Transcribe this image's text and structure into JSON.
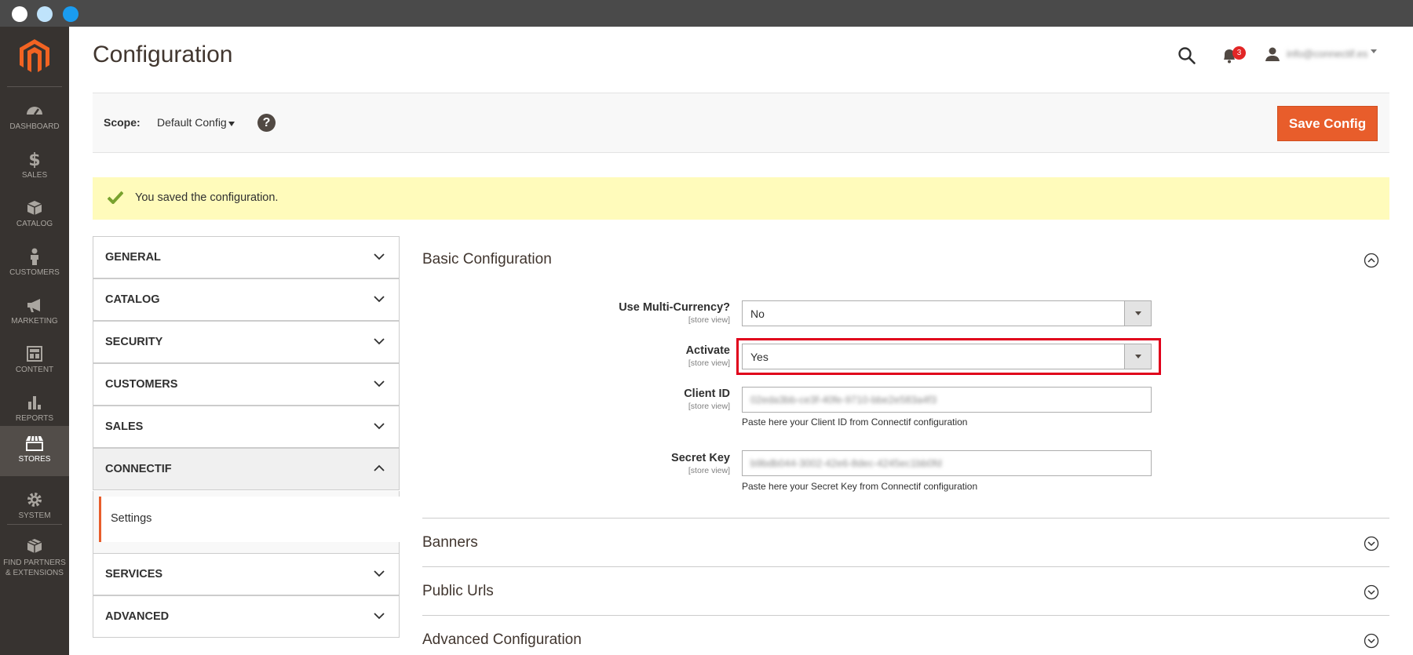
{
  "window": {
    "dot_colors": [
      "#ffffff",
      "#bfe3fb",
      "#1a9cf0"
    ]
  },
  "sidebar": {
    "items": [
      {
        "label": "DASHBOARD",
        "icon": "dashboard-icon"
      },
      {
        "label": "SALES",
        "icon": "dollar-icon"
      },
      {
        "label": "CATALOG",
        "icon": "box-icon"
      },
      {
        "label": "CUSTOMERS",
        "icon": "person-icon"
      },
      {
        "label": "MARKETING",
        "icon": "megaphone-icon"
      },
      {
        "label": "CONTENT",
        "icon": "layout-icon"
      },
      {
        "label": "REPORTS",
        "icon": "bar-chart-icon"
      },
      {
        "label": "STORES",
        "icon": "store-icon",
        "active": true
      },
      {
        "label": "SYSTEM",
        "icon": "gear-icon"
      },
      {
        "label": "FIND PARTNERS & EXTENSIONS",
        "icon": "extensions-icon"
      }
    ]
  },
  "header": {
    "title": "Configuration",
    "notification_count": "3",
    "user_name": "info@connectif.es"
  },
  "scope": {
    "label": "Scope:",
    "value": "Default Config",
    "help_icon": "?",
    "save_label": "Save Config"
  },
  "message": {
    "text": "You saved the configuration."
  },
  "tabs": {
    "general": "GENERAL",
    "catalog": "CATALOG",
    "security": "SECURITY",
    "customers": "CUSTOMERS",
    "sales": "SALES",
    "connectif": "CONNECTIF",
    "settings": "Settings",
    "services": "SERVICES",
    "advanced": "ADVANCED"
  },
  "basic": {
    "title": "Basic Configuration",
    "multi_currency": {
      "label": "Use Multi-Currency?",
      "scope": "[store view]",
      "value": "No"
    },
    "activate": {
      "label": "Activate",
      "scope": "[store view]",
      "value": "Yes"
    },
    "client_id": {
      "label": "Client ID",
      "scope": "[store view]",
      "value": "02eda3bb-ce3f-40fe-9710-bbe2e583a4f3",
      "note": "Paste here your Client ID from Connectif configuration"
    },
    "secret_key": {
      "label": "Secret Key",
      "scope": "[store view]",
      "value": "b9bdb044-3002-42e6-8dec-4245ec1bb0fd",
      "note": "Paste here your Secret Key from Connectif configuration"
    }
  },
  "sections": {
    "banners": "Banners",
    "public_urls": "Public Urls",
    "advanced_configuration": "Advanced Configuration"
  },
  "colors": {
    "accent": "#e85d2b",
    "sidebar": "#373330",
    "highlight": "#e0001b",
    "success": "#79a22e"
  }
}
